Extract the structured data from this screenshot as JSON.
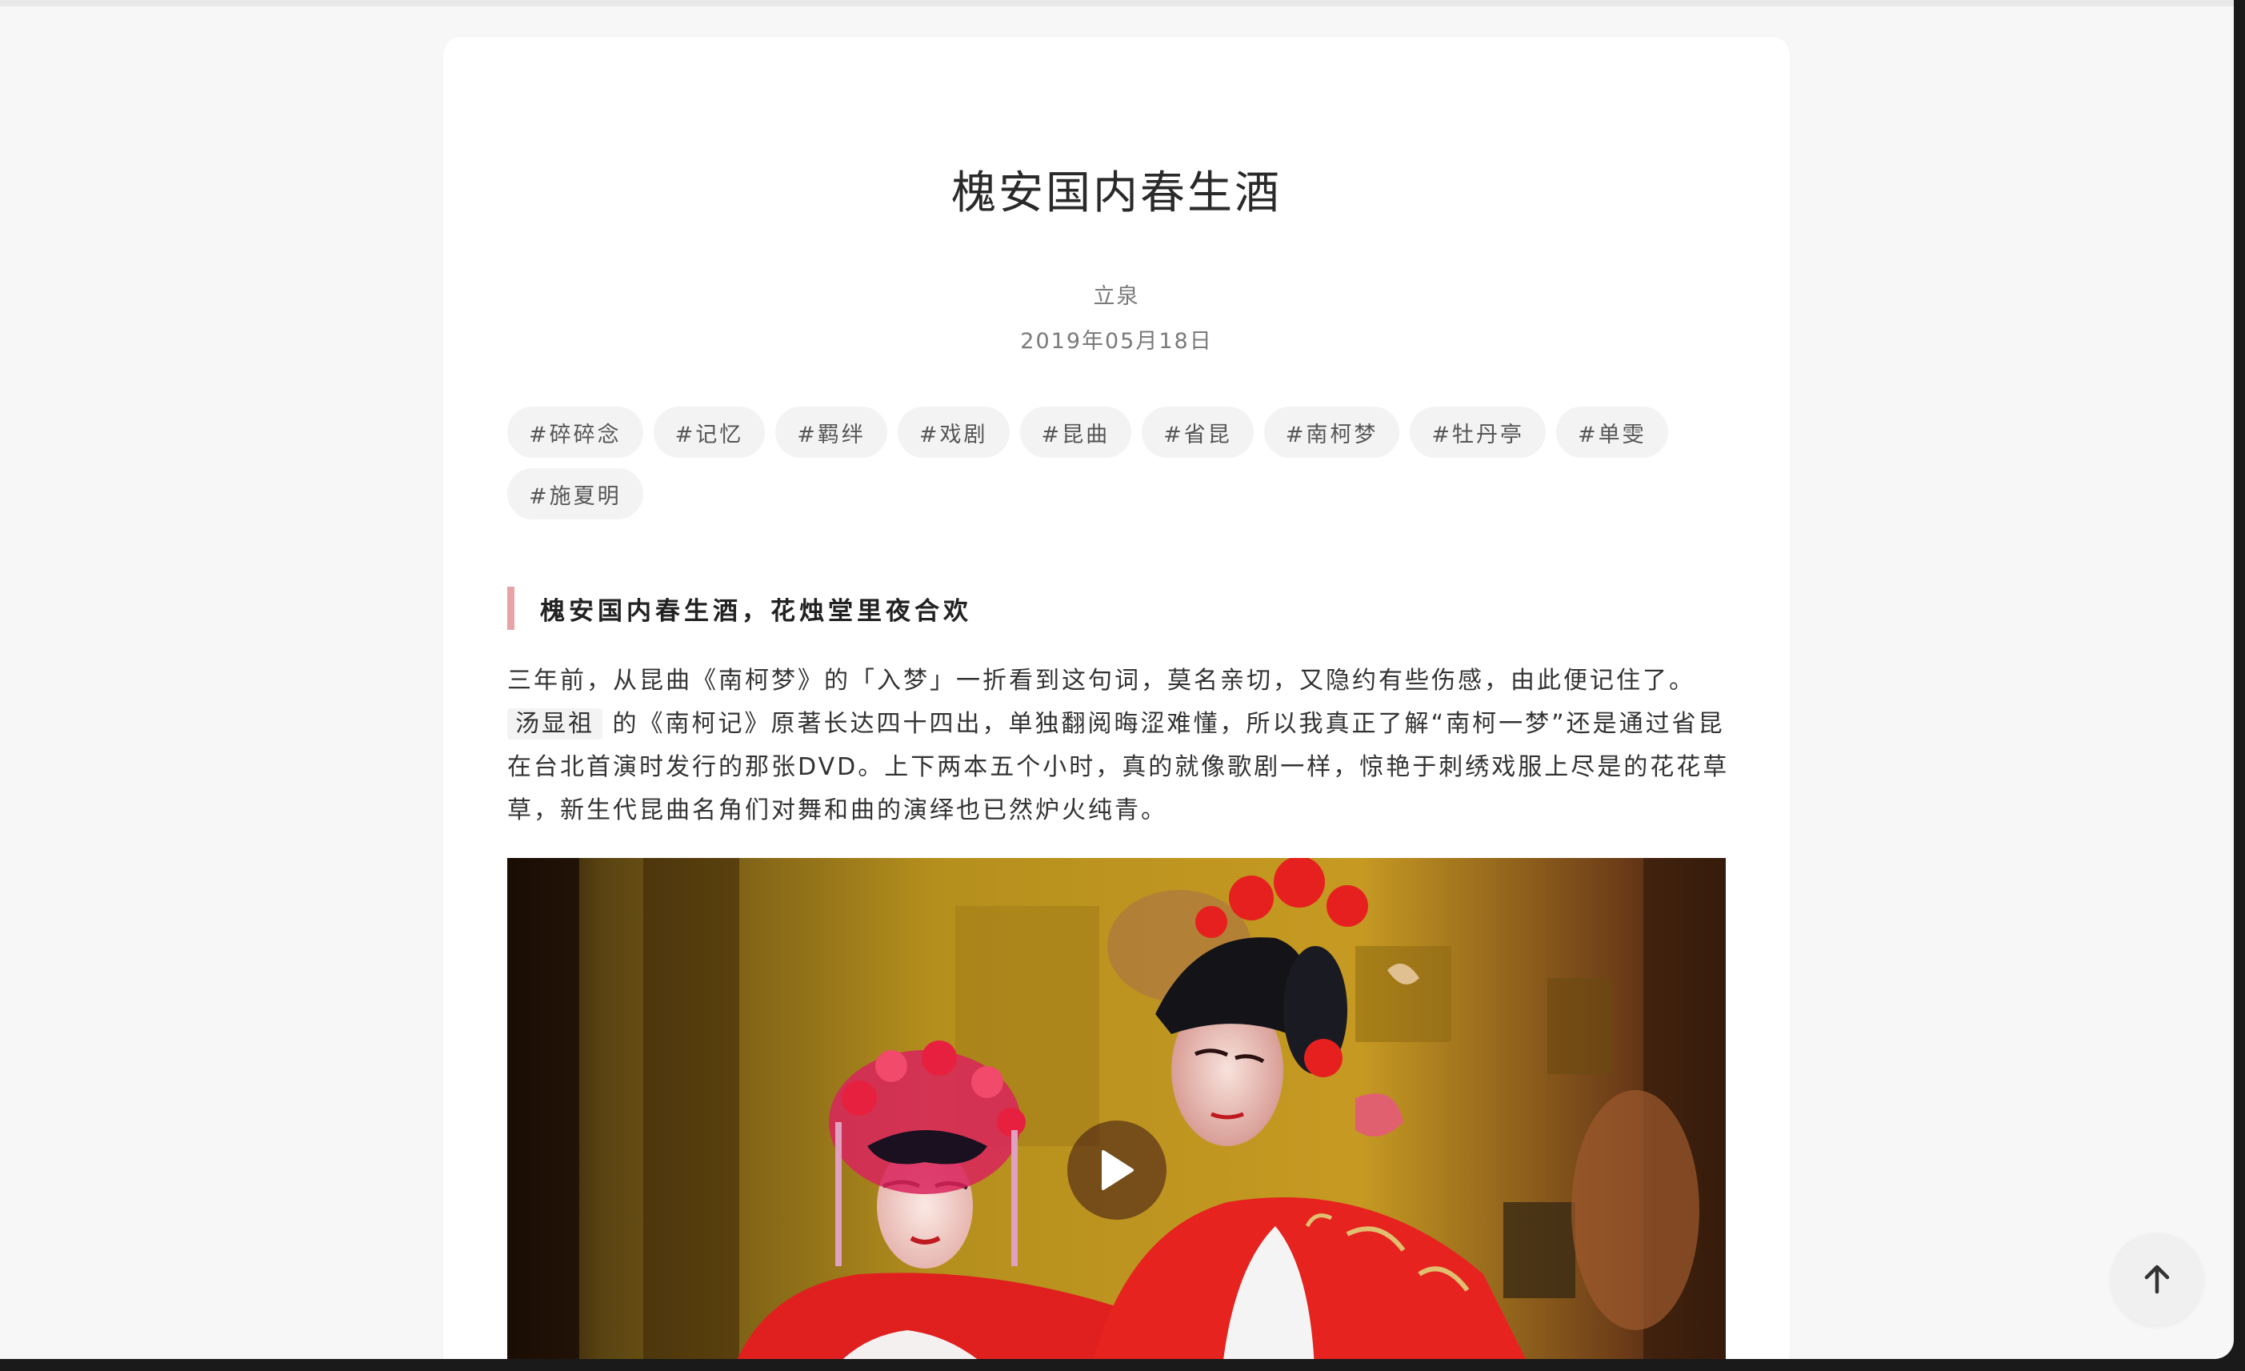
{
  "article": {
    "title": "槐安国内春生酒",
    "author": "立泉",
    "date": "2019年05月18日"
  },
  "tags": [
    "#碎碎念",
    "#记忆",
    "#羁绊",
    "#戏剧",
    "#昆曲",
    "#省昆",
    "#南柯梦",
    "#牡丹亭",
    "#单雯",
    "#施夏明"
  ],
  "quote": "槐安国内春生酒，花烛堂里夜合欢",
  "paragraph": {
    "part1": "三年前，从昆曲《南柯梦》的「入梦」一折看到这句词，莫名亲切，又隐约有些伤感，由此便记住了。",
    "link": "汤显祖",
    "part2": "的《南柯记》原著长达四十四出，单独翻阅晦涩难懂，所以我真正了解“南柯一梦”还是通过省昆在台北首演时发行的那张DVD。上下两本五个小时，真的就像歌剧一样，惊艳于刺绣戏服上尽是的花花草草，新生代昆曲名角们对舞和曲的演绎也已然炉火纯青。"
  },
  "video": {
    "play_icon": "play-icon"
  },
  "controls": {
    "scroll_top_icon": "arrow-up-icon"
  },
  "colors": {
    "quote_bar": "#e6a4a7",
    "tag_bg": "#f3f3f3",
    "page_bg": "#f7f7f7"
  }
}
